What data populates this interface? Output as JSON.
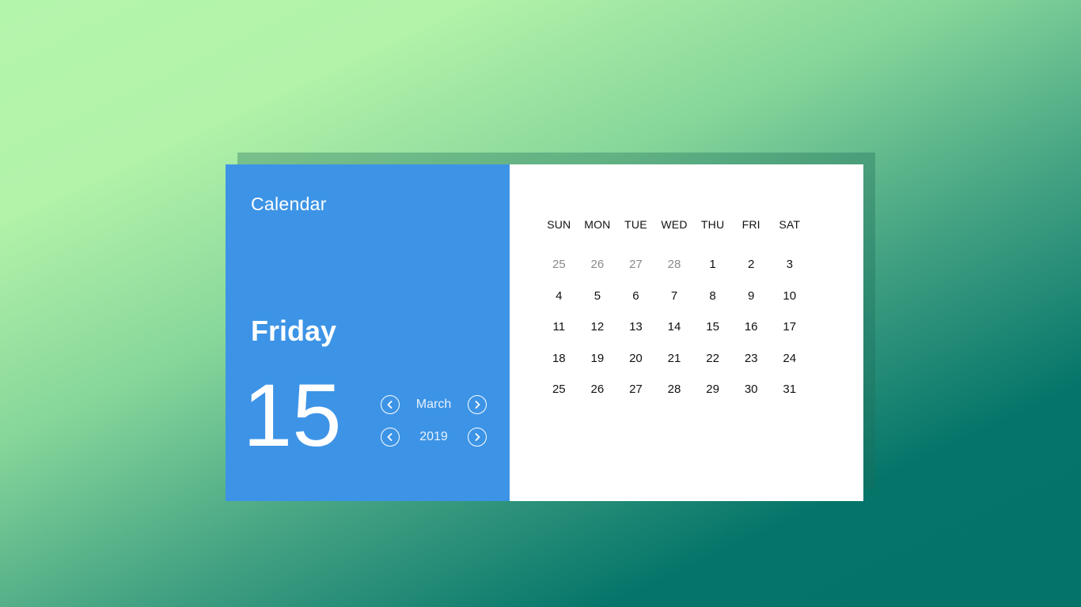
{
  "app": {
    "title": "Calendar"
  },
  "selected": {
    "weekday": "Friday",
    "day": "15"
  },
  "nav": {
    "month": "March",
    "year": "2019",
    "prev_icon": "chevron-left-icon",
    "next_icon": "chevron-right-icon"
  },
  "calendar": {
    "weekdays": [
      "SUN",
      "MON",
      "TUE",
      "WED",
      "THU",
      "FRI",
      "SAT"
    ],
    "weeks": [
      [
        {
          "d": "25",
          "other": true
        },
        {
          "d": "26",
          "other": true
        },
        {
          "d": "27",
          "other": true
        },
        {
          "d": "28",
          "other": true
        },
        {
          "d": "1"
        },
        {
          "d": "2"
        },
        {
          "d": "3"
        }
      ],
      [
        {
          "d": "4"
        },
        {
          "d": "5"
        },
        {
          "d": "6"
        },
        {
          "d": "7"
        },
        {
          "d": "8"
        },
        {
          "d": "9"
        },
        {
          "d": "10"
        }
      ],
      [
        {
          "d": "11"
        },
        {
          "d": "12"
        },
        {
          "d": "13"
        },
        {
          "d": "14"
        },
        {
          "d": "15"
        },
        {
          "d": "16"
        },
        {
          "d": "17"
        }
      ],
      [
        {
          "d": "18"
        },
        {
          "d": "19"
        },
        {
          "d": "20"
        },
        {
          "d": "21"
        },
        {
          "d": "22"
        },
        {
          "d": "23"
        },
        {
          "d": "24"
        }
      ],
      [
        {
          "d": "25"
        },
        {
          "d": "26"
        },
        {
          "d": "27"
        },
        {
          "d": "28"
        },
        {
          "d": "29"
        },
        {
          "d": "30"
        },
        {
          "d": "31"
        }
      ]
    ]
  },
  "colors": {
    "panel": "#3d94e6",
    "grid_bg": "#ffffff",
    "other_month_text": "#8a8a8a"
  }
}
